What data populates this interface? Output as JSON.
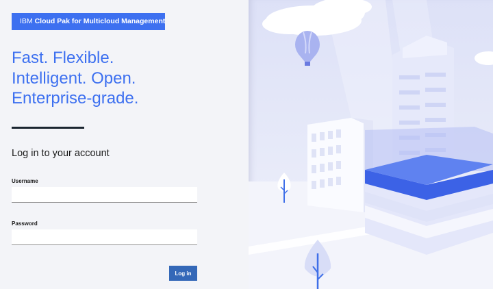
{
  "brand": {
    "company": "IBM",
    "product": "Cloud Pak for Multicloud Management"
  },
  "tagline": {
    "line1": "Fast. Flexible.",
    "line2": "Intelligent. Open.",
    "line3": "Enterprise-grade."
  },
  "login": {
    "heading": "Log in to your account",
    "username_label": "Username",
    "username_value": "",
    "password_label": "Password",
    "password_value": "",
    "submit_label": "Log in"
  },
  "colors": {
    "accent": "#3d70f0",
    "button": "#3468b8",
    "background": "#f3f4f8",
    "rule": "#1a2530"
  },
  "illustration": {
    "name": "city-illustration",
    "elements": [
      "cloud",
      "hot-air-balloon",
      "office-building",
      "tall-tower",
      "platform-stack",
      "tree",
      "road"
    ]
  }
}
